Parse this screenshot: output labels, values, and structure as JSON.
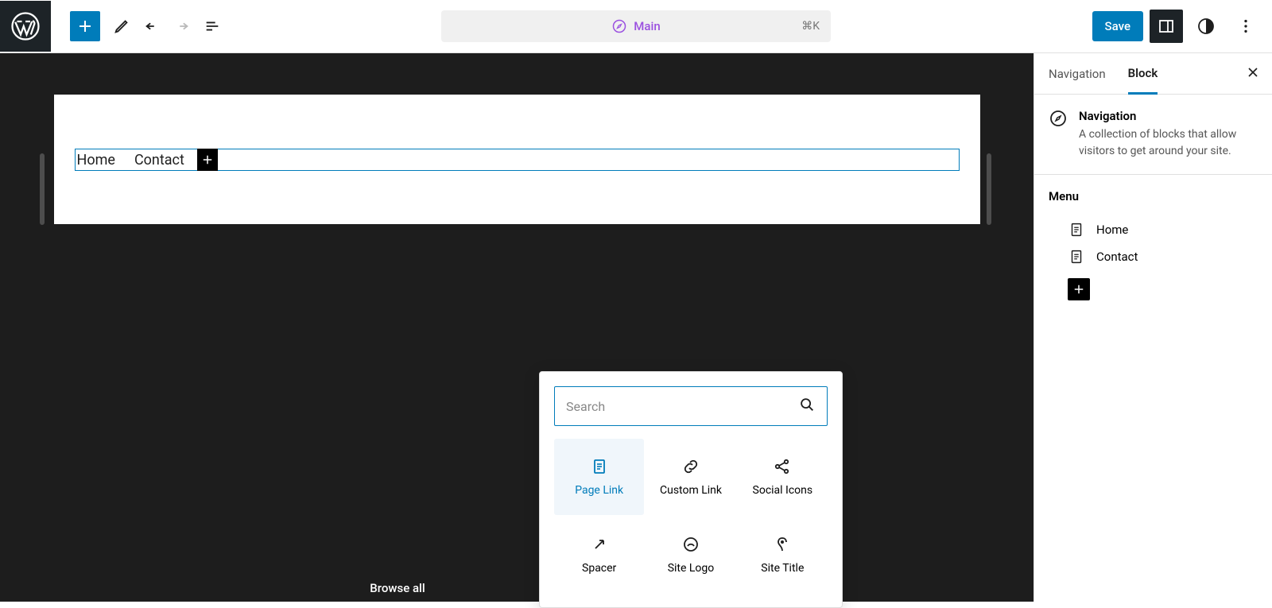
{
  "topbar": {
    "template_name": "Main",
    "shortcut": "⌘K",
    "save_label": "Save"
  },
  "canvas": {
    "nav_items": [
      "Home",
      "Contact"
    ]
  },
  "sidebar": {
    "tabs": {
      "navigation": "Navigation",
      "block": "Block"
    },
    "block_title": "Navigation",
    "block_desc": "A collection of blocks that allow visitors to get around your site.",
    "menu_heading": "Menu",
    "menu_items": [
      "Home",
      "Contact"
    ]
  },
  "inserter": {
    "placeholder": "Search",
    "options": [
      "Page Link",
      "Custom Link",
      "Social Icons",
      "Spacer",
      "Site Logo",
      "Site Title"
    ]
  },
  "browse_all": "Browse all"
}
